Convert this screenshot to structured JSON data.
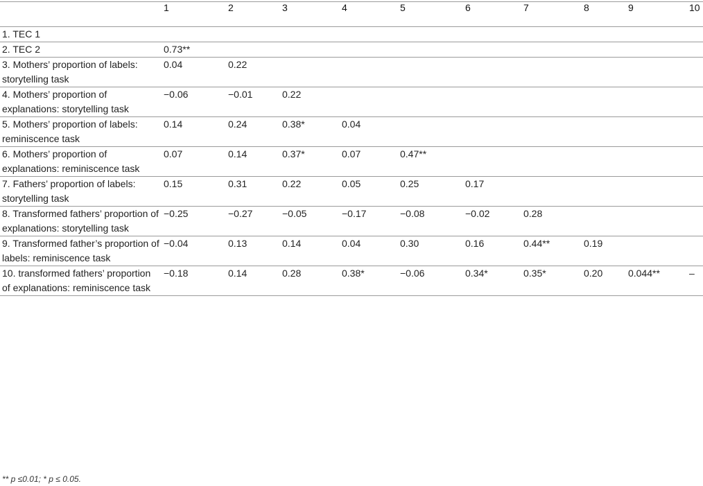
{
  "table": {
    "columns": [
      "",
      "1",
      "2",
      "3",
      "4",
      "5",
      "6",
      "7",
      "8",
      "9",
      "10"
    ],
    "rows": [
      {
        "label": "1. TEC 1",
        "cells": [
          "",
          "",
          "",
          "",
          "",
          "",
          "",
          "",
          "",
          ""
        ]
      },
      {
        "label": "2. TEC 2",
        "cells": [
          "0.73**",
          "",
          "",
          "",
          "",
          "",
          "",
          "",
          "",
          ""
        ]
      },
      {
        "label": "3. Mothers’ proportion of labels: storytelling task",
        "cells": [
          "0.04",
          "0.22",
          "",
          "",
          "",
          "",
          "",
          "",
          "",
          ""
        ]
      },
      {
        "label": "4. Mothers’ proportion of explanations: storytelling task",
        "cells": [
          "−0.06",
          "−0.01",
          "0.22",
          "",
          "",
          "",
          "",
          "",
          "",
          ""
        ]
      },
      {
        "label": "5. Mothers’ proportion of labels: reminiscence task",
        "cells": [
          "0.14",
          "0.24",
          "0.38*",
          "0.04",
          "",
          "",
          "",
          "",
          "",
          ""
        ]
      },
      {
        "label": "6. Mothers’ proportion of explanations: reminiscence task",
        "cells": [
          "0.07",
          "0.14",
          "0.37*",
          "0.07",
          "0.47**",
          "",
          "",
          "",
          "",
          ""
        ]
      },
      {
        "label": "7. Fathers’ proportion of labels: storytelling task",
        "cells": [
          "0.15",
          "0.31",
          "0.22",
          "0.05",
          "0.25",
          "0.17",
          "",
          "",
          "",
          ""
        ]
      },
      {
        "label": "8. Transformed fathers’ proportion of explanations: storytelling task",
        "cells": [
          "−0.25",
          "−0.27",
          "−0.05",
          "−0.17",
          "−0.08",
          "−0.02",
          "0.28",
          "",
          "",
          ""
        ]
      },
      {
        "label": "9. Transformed father’s proportion of labels: reminiscence task",
        "cells": [
          "−0.04",
          "0.13",
          "0.14",
          "0.04",
          "0.30",
          "0.16",
          "0.44**",
          "0.19",
          "",
          ""
        ]
      },
      {
        "label": "10. transformed fathers’ proportion of explanations: reminiscence task",
        "cells": [
          "−0.18",
          "0.14",
          "0.28",
          "0.38*",
          "−0.06",
          "0.34*",
          "0.35*",
          "0.20",
          "0.044**",
          "–"
        ]
      }
    ]
  },
  "footnote": "** p ≤0.01; * p ≤ 0.05."
}
